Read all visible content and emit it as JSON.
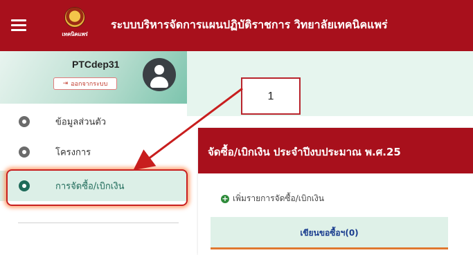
{
  "header": {
    "title": "ระบบบริหารจัดการแผนปฏิบัติราชการ วิทยาลัยเทคนิคแพร่",
    "logo_text": "เทคนิคแพร่",
    "menu_icon": "hamburger-icon",
    "background": "#a8101c"
  },
  "sidebar": {
    "profile": {
      "username": "PTCdep31",
      "logout_label": "ออกจากระบบ",
      "logout_icon": "sign-out-icon",
      "avatar_icon": "user-avatar-icon"
    },
    "items": [
      {
        "label": "ข้อมูลส่วนตัว",
        "active": false
      },
      {
        "label": "โครงการ",
        "active": false
      },
      {
        "label": "การจัดซื้อ/เบิกเงิน",
        "active": true
      }
    ],
    "accent": "#1f6b5a"
  },
  "main": {
    "card_title": "จัดซื้อ/เบิกเงิน ประจำปีงบประมาณ พ.ศ.25",
    "add_link": "เพิ่มรายการจัดซื้อ/เบิกเงิน",
    "add_icon": "plus-circle-icon",
    "tabs": [
      {
        "label": "เขียนขอซื้อฯ(0)",
        "active": true
      }
    ]
  },
  "annotation": {
    "callout_number": "1",
    "color": "#c81e1e"
  }
}
